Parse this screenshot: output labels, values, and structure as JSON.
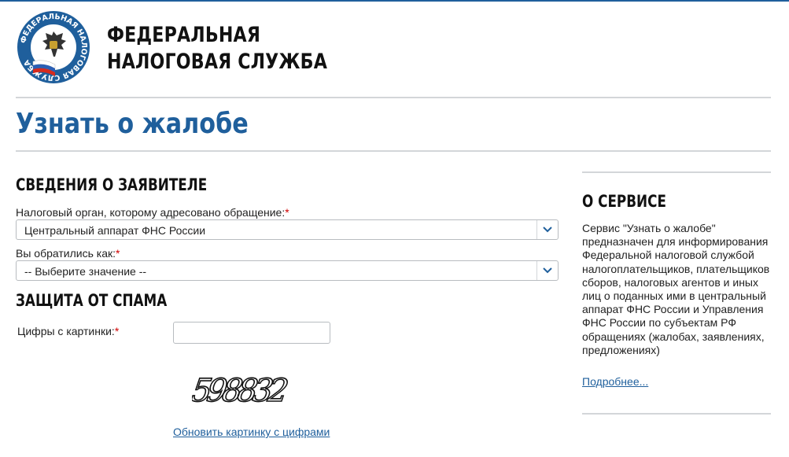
{
  "header": {
    "org_line1": "ФЕДЕРАЛЬНАЯ",
    "org_line2": "НАЛОГОВАЯ СЛУЖБА",
    "logo_ring_text": "ФЕДЕРАЛЬНАЯ НАЛОГОВАЯ СЛУЖБА",
    "brand_color": "#1f5f9c"
  },
  "page": {
    "title": "Узнать о жалобе"
  },
  "applicant": {
    "heading": "СВЕДЕНИЯ О ЗАЯВИТЕЛЕ",
    "tax_authority": {
      "label": "Налоговый орган, которому адресовано обращение:",
      "value": "Центральный аппарат ФНС России"
    },
    "applied_as": {
      "label": "Вы обратились как:",
      "value": "-- Выберите значение --"
    },
    "required_mark": "*"
  },
  "spam": {
    "heading": "ЗАЩИТА ОТ СПАМА",
    "label": "Цифры с картинки:",
    "input_value": "",
    "captcha_text": "598832",
    "refresh_link": "Обновить картинку с цифрами"
  },
  "sidebar": {
    "heading": "О СЕРВИСЕ",
    "text": "Сервис \"Узнать о жалобе\" предназначен для информирования Федеральной налоговой службой налогоплательщиков, плательщиков сборов, налоговых агентов и иных лиц о поданных ими в центральный аппарат ФНС России и Управления ФНС России по субъектам РФ обращениях (жалобах, заявлениях, предложениях)",
    "more_link": "Подробнее..."
  },
  "icons": {
    "logo": "fns-emblem-icon",
    "dropdown": "chevron-down-icon"
  }
}
